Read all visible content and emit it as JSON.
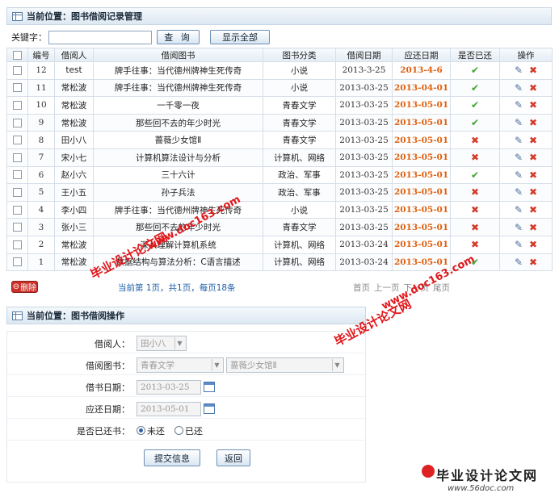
{
  "list_panel": {
    "title": "当前位置：图书借阅记录管理",
    "search": {
      "label": "关键字：",
      "value": "",
      "placeholder": ""
    },
    "query_button": "查 询",
    "show_all_button": "显示全部",
    "columns": [
      "编号",
      "借阅人",
      "借阅图书",
      "图书分类",
      "借阅日期",
      "应还日期",
      "是否已还",
      "操作"
    ],
    "rows": [
      {
        "id": "12",
        "borrower": "test",
        "book": "牌手往事：当代德州牌神生死传奇",
        "category": "小说",
        "borrow_date": "2013-3-25",
        "due_date": "2013-4-6",
        "returned": true
      },
      {
        "id": "11",
        "borrower": "常松波",
        "book": "牌手往事：当代德州牌神生死传奇",
        "category": "小说",
        "borrow_date": "2013-03-25",
        "due_date": "2013-04-01",
        "returned": true
      },
      {
        "id": "10",
        "borrower": "常松波",
        "book": "一千零一夜",
        "category": "青春文学",
        "borrow_date": "2013-03-25",
        "due_date": "2013-05-01",
        "returned": true
      },
      {
        "id": "9",
        "borrower": "常松波",
        "book": "那些回不去的年少时光",
        "category": "青春文学",
        "borrow_date": "2013-03-25",
        "due_date": "2013-05-01",
        "returned": true
      },
      {
        "id": "8",
        "borrower": "田小八",
        "book": "蔷薇少女馆Ⅱ",
        "category": "青春文学",
        "borrow_date": "2013-03-25",
        "due_date": "2013-05-01",
        "returned": false
      },
      {
        "id": "7",
        "borrower": "宋小七",
        "book": "计算机算法设计与分析",
        "category": "计算机、网络",
        "borrow_date": "2013-03-25",
        "due_date": "2013-05-01",
        "returned": false
      },
      {
        "id": "6",
        "borrower": "赵小六",
        "book": "三十六计",
        "category": "政治、军事",
        "borrow_date": "2013-03-25",
        "due_date": "2013-05-01",
        "returned": true
      },
      {
        "id": "5",
        "borrower": "王小五",
        "book": "孙子兵法",
        "category": "政治、军事",
        "borrow_date": "2013-03-25",
        "due_date": "2013-05-01",
        "returned": false
      },
      {
        "id": "4",
        "borrower": "李小四",
        "book": "牌手往事：当代德州牌神生死传奇",
        "category": "小说",
        "borrow_date": "2013-03-25",
        "due_date": "2013-05-01",
        "returned": false
      },
      {
        "id": "3",
        "borrower": "张小三",
        "book": "那些回不去的年少时光",
        "category": "青春文学",
        "borrow_date": "2013-03-25",
        "due_date": "2013-05-01",
        "returned": false
      },
      {
        "id": "2",
        "borrower": "常松波",
        "book": "深入理解计算机系统",
        "category": "计算机、网络",
        "borrow_date": "2013-03-24",
        "due_date": "2013-05-01",
        "returned": false
      },
      {
        "id": "1",
        "borrower": "常松波",
        "book": "数据结构与算法分析：C语言描述",
        "category": "计算机、网络",
        "borrow_date": "2013-03-24",
        "due_date": "2013-05-01",
        "returned": true
      }
    ],
    "delete_button": "删除",
    "page_info": "当前第 1页，共1页，每页18条",
    "pager": [
      "首页",
      "上一页",
      "下一页",
      "尾页"
    ]
  },
  "form_panel": {
    "title": "当前位置：图书借阅操作",
    "borrower_label": "借阅人：",
    "borrower_value": "田小八",
    "book_label": "借阅图书：",
    "book_category_value": "青春文学",
    "book_value": "蔷薇少女馆Ⅱ",
    "borrow_date_label": "借书日期：",
    "borrow_date_value": "2013-03-25",
    "due_date_label": "应还日期：",
    "due_date_value": "2013-05-01",
    "returned_label": "是否已还书：",
    "returned_options": [
      "未还",
      "已还"
    ],
    "returned_selected": "未还",
    "submit_button": "提交信息",
    "back_button": "返回"
  },
  "watermarks": {
    "w1": "毕业设计论文网",
    "w2": "www.doc163.com",
    "footer_line1": "毕业设计论文网",
    "footer_line2": "www.56doc.com"
  },
  "colors": {
    "due_date": "#e06010",
    "returned_ok": "#3aa52a",
    "not_returned": "#d33a2a",
    "watermark": "#e0171b"
  }
}
